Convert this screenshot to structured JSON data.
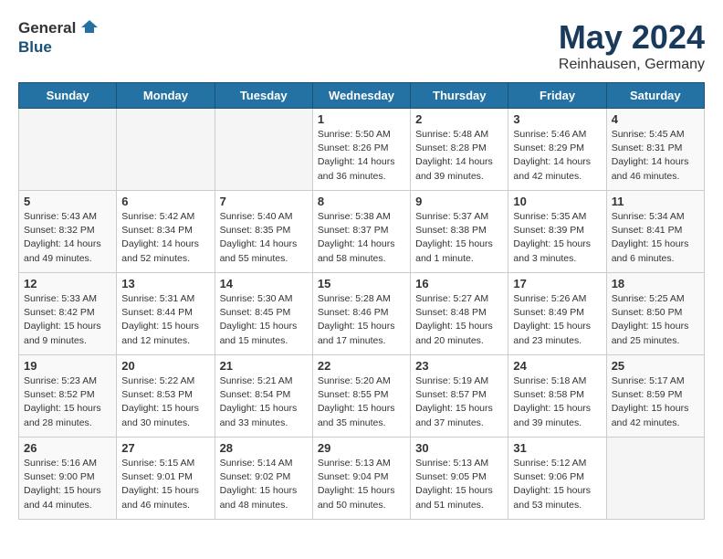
{
  "header": {
    "logo_general": "General",
    "logo_blue": "Blue",
    "title": "May 2024",
    "subtitle": "Reinhausen, Germany"
  },
  "weekdays": [
    "Sunday",
    "Monday",
    "Tuesday",
    "Wednesday",
    "Thursday",
    "Friday",
    "Saturday"
  ],
  "weeks": [
    [
      {
        "day": "",
        "info": ""
      },
      {
        "day": "",
        "info": ""
      },
      {
        "day": "",
        "info": ""
      },
      {
        "day": "1",
        "info": "Sunrise: 5:50 AM\nSunset: 8:26 PM\nDaylight: 14 hours\nand 36 minutes."
      },
      {
        "day": "2",
        "info": "Sunrise: 5:48 AM\nSunset: 8:28 PM\nDaylight: 14 hours\nand 39 minutes."
      },
      {
        "day": "3",
        "info": "Sunrise: 5:46 AM\nSunset: 8:29 PM\nDaylight: 14 hours\nand 42 minutes."
      },
      {
        "day": "4",
        "info": "Sunrise: 5:45 AM\nSunset: 8:31 PM\nDaylight: 14 hours\nand 46 minutes."
      }
    ],
    [
      {
        "day": "5",
        "info": "Sunrise: 5:43 AM\nSunset: 8:32 PM\nDaylight: 14 hours\nand 49 minutes."
      },
      {
        "day": "6",
        "info": "Sunrise: 5:42 AM\nSunset: 8:34 PM\nDaylight: 14 hours\nand 52 minutes."
      },
      {
        "day": "7",
        "info": "Sunrise: 5:40 AM\nSunset: 8:35 PM\nDaylight: 14 hours\nand 55 minutes."
      },
      {
        "day": "8",
        "info": "Sunrise: 5:38 AM\nSunset: 8:37 PM\nDaylight: 14 hours\nand 58 minutes."
      },
      {
        "day": "9",
        "info": "Sunrise: 5:37 AM\nSunset: 8:38 PM\nDaylight: 15 hours\nand 1 minute."
      },
      {
        "day": "10",
        "info": "Sunrise: 5:35 AM\nSunset: 8:39 PM\nDaylight: 15 hours\nand 3 minutes."
      },
      {
        "day": "11",
        "info": "Sunrise: 5:34 AM\nSunset: 8:41 PM\nDaylight: 15 hours\nand 6 minutes."
      }
    ],
    [
      {
        "day": "12",
        "info": "Sunrise: 5:33 AM\nSunset: 8:42 PM\nDaylight: 15 hours\nand 9 minutes."
      },
      {
        "day": "13",
        "info": "Sunrise: 5:31 AM\nSunset: 8:44 PM\nDaylight: 15 hours\nand 12 minutes."
      },
      {
        "day": "14",
        "info": "Sunrise: 5:30 AM\nSunset: 8:45 PM\nDaylight: 15 hours\nand 15 minutes."
      },
      {
        "day": "15",
        "info": "Sunrise: 5:28 AM\nSunset: 8:46 PM\nDaylight: 15 hours\nand 17 minutes."
      },
      {
        "day": "16",
        "info": "Sunrise: 5:27 AM\nSunset: 8:48 PM\nDaylight: 15 hours\nand 20 minutes."
      },
      {
        "day": "17",
        "info": "Sunrise: 5:26 AM\nSunset: 8:49 PM\nDaylight: 15 hours\nand 23 minutes."
      },
      {
        "day": "18",
        "info": "Sunrise: 5:25 AM\nSunset: 8:50 PM\nDaylight: 15 hours\nand 25 minutes."
      }
    ],
    [
      {
        "day": "19",
        "info": "Sunrise: 5:23 AM\nSunset: 8:52 PM\nDaylight: 15 hours\nand 28 minutes."
      },
      {
        "day": "20",
        "info": "Sunrise: 5:22 AM\nSunset: 8:53 PM\nDaylight: 15 hours\nand 30 minutes."
      },
      {
        "day": "21",
        "info": "Sunrise: 5:21 AM\nSunset: 8:54 PM\nDaylight: 15 hours\nand 33 minutes."
      },
      {
        "day": "22",
        "info": "Sunrise: 5:20 AM\nSunset: 8:55 PM\nDaylight: 15 hours\nand 35 minutes."
      },
      {
        "day": "23",
        "info": "Sunrise: 5:19 AM\nSunset: 8:57 PM\nDaylight: 15 hours\nand 37 minutes."
      },
      {
        "day": "24",
        "info": "Sunrise: 5:18 AM\nSunset: 8:58 PM\nDaylight: 15 hours\nand 39 minutes."
      },
      {
        "day": "25",
        "info": "Sunrise: 5:17 AM\nSunset: 8:59 PM\nDaylight: 15 hours\nand 42 minutes."
      }
    ],
    [
      {
        "day": "26",
        "info": "Sunrise: 5:16 AM\nSunset: 9:00 PM\nDaylight: 15 hours\nand 44 minutes."
      },
      {
        "day": "27",
        "info": "Sunrise: 5:15 AM\nSunset: 9:01 PM\nDaylight: 15 hours\nand 46 minutes."
      },
      {
        "day": "28",
        "info": "Sunrise: 5:14 AM\nSunset: 9:02 PM\nDaylight: 15 hours\nand 48 minutes."
      },
      {
        "day": "29",
        "info": "Sunrise: 5:13 AM\nSunset: 9:04 PM\nDaylight: 15 hours\nand 50 minutes."
      },
      {
        "day": "30",
        "info": "Sunrise: 5:13 AM\nSunset: 9:05 PM\nDaylight: 15 hours\nand 51 minutes."
      },
      {
        "day": "31",
        "info": "Sunrise: 5:12 AM\nSunset: 9:06 PM\nDaylight: 15 hours\nand 53 minutes."
      },
      {
        "day": "",
        "info": ""
      }
    ]
  ]
}
